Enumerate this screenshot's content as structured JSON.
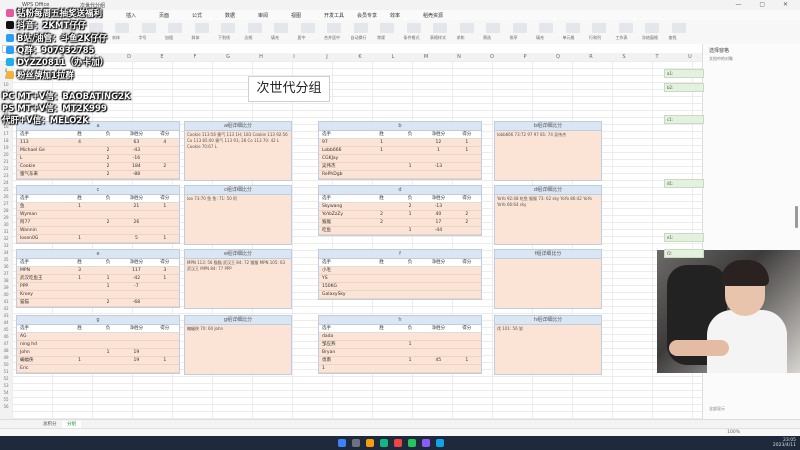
{
  "window": {
    "tabs": [
      "WPS Office",
      "次世代分组"
    ],
    "controls": "— ▢ ✕"
  },
  "menu": [
    "文件",
    "开始",
    "插入",
    "页面",
    "公式",
    "数据",
    "审阅",
    "视图",
    "开发工具",
    "会员专享",
    "效率",
    "稻壳资源"
  ],
  "ribbon": [
    "粘贴",
    "格式刷",
    "剪切",
    "复制",
    "宋体",
    "字号",
    "加粗",
    "斜体",
    "下划线",
    "边框",
    "填充",
    "居中",
    "合并居中",
    "自动换行",
    "常规",
    "条件格式",
    "表格样式",
    "求和",
    "筛选",
    "排序",
    "填充",
    "单元格",
    "行和列",
    "工作表",
    "冻结窗格",
    "查找"
  ],
  "formula": {
    "fx": "fx"
  },
  "columns": [
    "A",
    "B",
    "C",
    "D",
    "E",
    "F",
    "G",
    "H",
    "I",
    "J",
    "K",
    "L",
    "M",
    "N",
    "O",
    "P",
    "Q",
    "R",
    "S",
    "T",
    "U"
  ],
  "title": "次世代分组",
  "group_tables": [
    {
      "name": "a",
      "headers": [
        "选手",
        "胜",
        "负",
        "净胜分",
        "得分"
      ],
      "rows": [
        [
          "113",
          "4",
          "",
          "63",
          "4"
        ],
        [
          "Michael Ge",
          "",
          "2",
          "-43",
          ""
        ],
        [
          "L",
          "",
          "2",
          "-16",
          ""
        ],
        [
          "Cookie",
          "",
          "2",
          "184",
          "2"
        ],
        [
          "蜜气东来",
          "",
          "2",
          "-88",
          ""
        ]
      ]
    },
    {
      "name": "b",
      "headers": [
        "选手",
        "胜",
        "负",
        "净胜分",
        "得分"
      ],
      "rows": [
        [
          "97",
          "1",
          "",
          "12",
          "1"
        ],
        [
          "Lobb666",
          "1",
          "",
          "1",
          "1"
        ],
        [
          "CGKJay",
          "",
          "",
          "",
          ""
        ],
        [
          "吴伟杰",
          "",
          "1",
          "-13",
          ""
        ],
        [
          "RePhDgb",
          "",
          "",
          "",
          ""
        ]
      ]
    },
    {
      "name": "c",
      "headers": [
        "选手",
        "胜",
        "负",
        "净胜分",
        "得分"
      ],
      "rows": [
        [
          "鱼",
          "1",
          "",
          "21",
          "1"
        ],
        [
          "Wyman",
          "",
          "",
          "",
          ""
        ],
        [
          "阿77",
          "",
          "2",
          "26",
          ""
        ],
        [
          "Wannin",
          "",
          "",
          "",
          ""
        ],
        [
          "losen0G",
          "1",
          "",
          "5",
          "1"
        ]
      ]
    },
    {
      "name": "d",
      "headers": [
        "选手",
        "胜",
        "负",
        "净胜分",
        "得分"
      ],
      "rows": [
        [
          "Skywang",
          "",
          "2",
          "-13",
          ""
        ],
        [
          "YoYoZzZy",
          "2",
          "1",
          "40",
          "2"
        ],
        [
          "猴猴",
          "2",
          "",
          "17",
          "2"
        ],
        [
          "吃鱼",
          "",
          "1",
          "-44",
          ""
        ]
      ]
    },
    {
      "name": "e",
      "headers": [
        "选手",
        "胜",
        "负",
        "净胜分",
        "得分"
      ],
      "rows": [
        [
          "MPN",
          "3",
          "",
          "117",
          "3"
        ],
        [
          "武汉吃鱼王",
          "1",
          "1",
          "-42",
          "1"
        ],
        [
          "PPP",
          "",
          "1",
          "-7",
          ""
        ],
        [
          "Kroey",
          "",
          "",
          "",
          ""
        ],
        [
          "猫猫",
          "",
          "2",
          "-68",
          ""
        ]
      ]
    },
    {
      "name": "f",
      "headers": [
        "选手",
        "胜",
        "负",
        "净胜分",
        "得分"
      ],
      "rows": [
        [
          "小毛",
          "",
          "",
          "",
          ""
        ],
        [
          "YS",
          "",
          "",
          "",
          ""
        ],
        [
          "150KG",
          "",
          "",
          "",
          ""
        ],
        [
          "GalaxySky",
          "",
          "",
          "",
          ""
        ]
      ]
    },
    {
      "name": "g",
      "headers": [
        "选手",
        "胜",
        "负",
        "净胜分",
        "得分"
      ],
      "rows": [
        [
          "AG",
          "",
          "",
          "",
          ""
        ],
        [
          "ning hd",
          "",
          "",
          "",
          ""
        ],
        [
          "John",
          "",
          "1",
          "19",
          ""
        ],
        [
          "蝙蝠侠",
          "1",
          "",
          "19",
          "1"
        ],
        [
          "Eric",
          "",
          "",
          "",
          ""
        ]
      ]
    },
    {
      "name": "h",
      "headers": [
        "选手",
        "胜",
        "负",
        "净胜分",
        "得分"
      ],
      "rows": [
        [
          "dada",
          "",
          "",
          "",
          ""
        ],
        [
          "邹应燕",
          "",
          "1",
          "",
          ""
        ],
        [
          "Bryan",
          "",
          "",
          "",
          ""
        ],
        [
          "伐南",
          "",
          "1",
          "45",
          "1"
        ],
        [
          "1",
          "",
          "",
          "",
          ""
        ]
      ]
    }
  ],
  "detail_tables": [
    {
      "name": "a组详细比分",
      "text": "Cookie 113:56 蜜气 113 1H; 183 Cookie 113 92:56 Co 113 85:00 蜜气 113 91; 28 Co 113 70: 42 L Cookie 70:67 L"
    },
    {
      "name": "b组详细比分",
      "text": "lobb666 73:72 97 97 81: 74 吴伟杰"
    },
    {
      "name": "c组详细比分",
      "text": "loo 73:70 鱼 鱼: 71: 50 阿"
    },
    {
      "name": "d组详细比分",
      "text": "YoYo 92:48 吃鱼 猴猴 73: 62 sky YoYo 86:42 YoYo YoYo 66:64 sky"
    },
    {
      "name": "e组详细比分",
      "text": "MPN 113: 56 猫猫 武汉王 84: 72 猫猫 MPN 105: 63 武汉王 MPN 84: 77 PPP"
    },
    {
      "name": "f组详细比分",
      "text": ""
    },
    {
      "name": "g组详细比分",
      "text": "蝙蝠侠 70: 60 John"
    },
    {
      "name": "h组详细比分",
      "text": "伐 101: 56 邹"
    }
  ],
  "side_cells": [
    "a1:",
    "b2:",
    "c1:",
    "d1:",
    "e1:",
    "f2:"
  ],
  "right_pane": {
    "title": "选择窗格",
    "subtitle": "文档中的对象",
    "footer": "全部显示"
  },
  "sheet_tabs": [
    "总积分",
    "分组"
  ],
  "active_sheet": "分组",
  "status": {
    "zoom": "100%"
  },
  "clock": {
    "time": "23:05",
    "date": "2023/4/11"
  },
  "overlay": {
    "lines": [
      {
        "icon_color": "#e85aa0",
        "text": "钻粉每周五抽奖送福利"
      },
      {
        "icon_color": "#111111",
        "text": "抖音：2KMT仔仔"
      },
      {
        "icon_color": "#2a9df4",
        "text": "B站/油管：斗鱼2K仔仔"
      },
      {
        "icon_color": "#2a9df4",
        "text": "Q群：907932785"
      },
      {
        "icon_color": "#1fb0e8",
        "text": "DYZZ0811（办卡加）"
      },
      {
        "icon_color": "#f2b33d",
        "text": "粉丝牌加1拉群"
      }
    ],
    "lines2": [
      "PC MT+V信：BAOBATING2K",
      "PS MT+V信：MT2K999",
      "代肝+V信：MELO2K"
    ]
  }
}
